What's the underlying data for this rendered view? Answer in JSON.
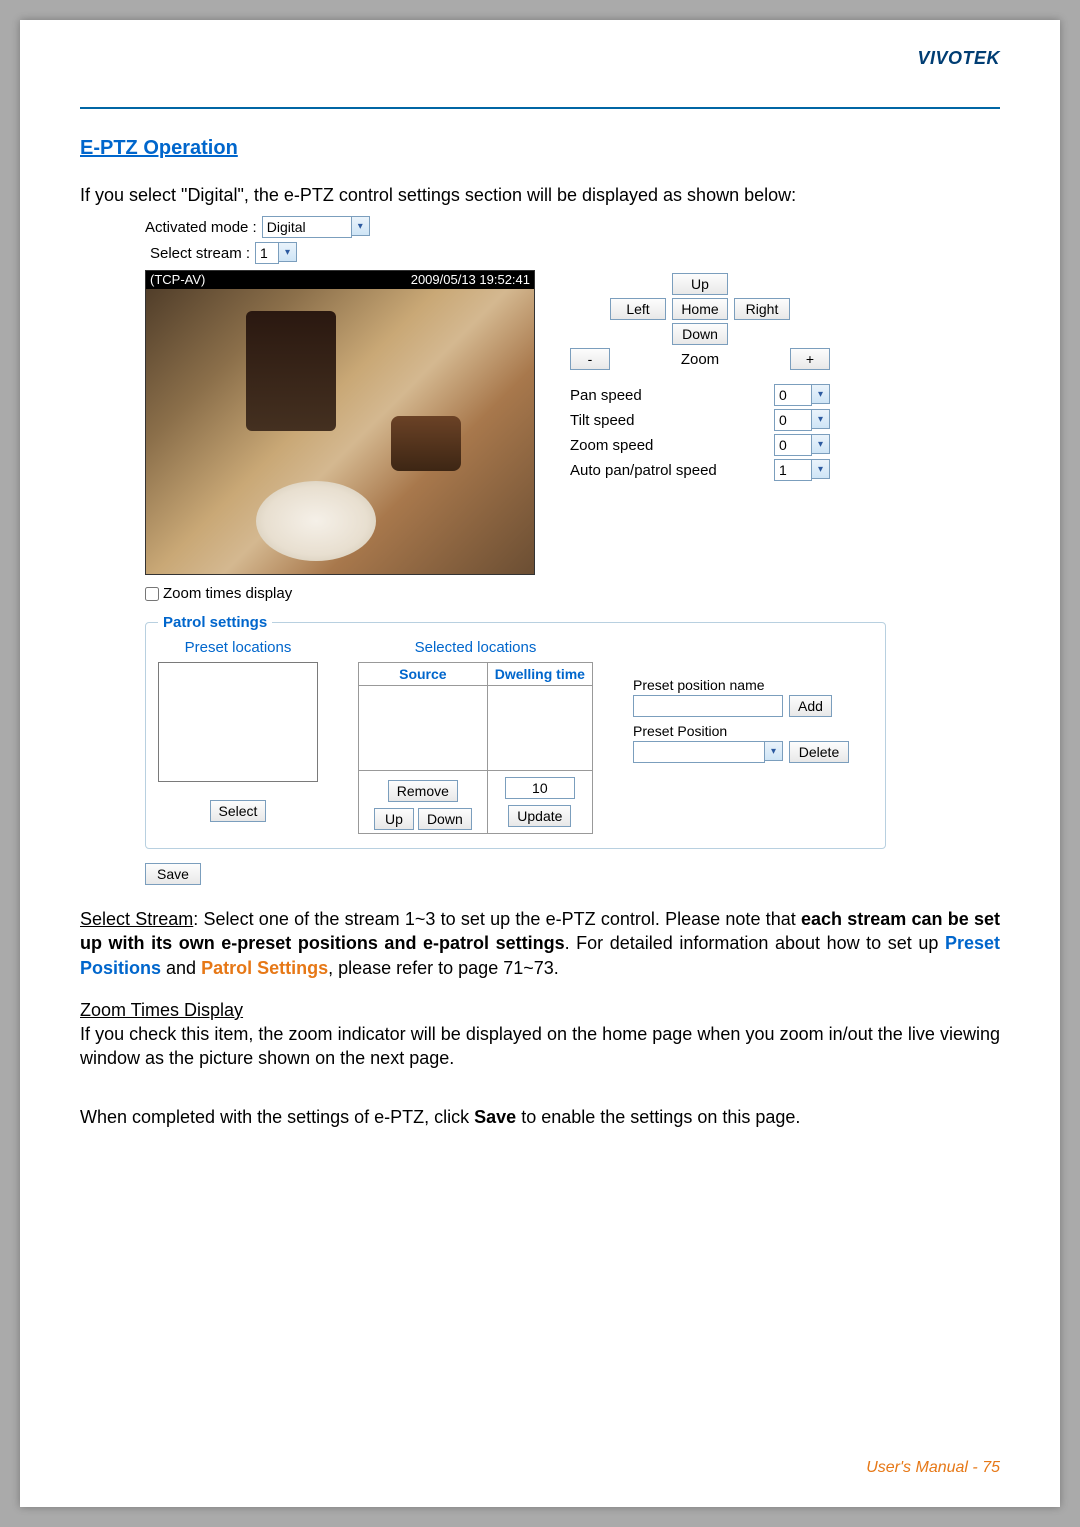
{
  "brand": "VIVOTEK",
  "section_title": "E-PTZ Operation",
  "intro": "If you select \"Digital\", the e-PTZ control settings section will be displayed as shown below:",
  "ui": {
    "activated_mode_label": "Activated mode :",
    "activated_mode_value": "Digital",
    "select_stream_label": "Select stream :",
    "select_stream_value": "1",
    "video_overlay_left": "(TCP-AV)",
    "video_overlay_right": "2009/05/13 19:52:41",
    "dpad": {
      "up": "Up",
      "left": "Left",
      "home": "Home",
      "right": "Right",
      "down": "Down"
    },
    "zoom": {
      "minus": "-",
      "label": "Zoom",
      "plus": "+"
    },
    "speeds": {
      "pan_label": "Pan speed",
      "pan_value": "0",
      "tilt_label": "Tilt speed",
      "tilt_value": "0",
      "zoom_label": "Zoom speed",
      "zoom_value": "0",
      "auto_label": "Auto pan/patrol speed",
      "auto_value": "1"
    },
    "zoom_times_display": "Zoom times display",
    "patrol": {
      "legend": "Patrol settings",
      "preset_locations": "Preset locations",
      "selected_locations": "Selected locations",
      "source": "Source",
      "dwelling_time": "Dwelling time",
      "select": "Select",
      "remove": "Remove",
      "up": "Up",
      "down": "Down",
      "dwell_value": "10",
      "update": "Update",
      "preset_position_name": "Preset position name",
      "add": "Add",
      "preset_position": "Preset Position",
      "delete": "Delete"
    },
    "save": "Save"
  },
  "body": {
    "p1_a": "Select Stream",
    "p1_b": ": Select one of the stream 1~3 to set up the e-PTZ control. Please note that ",
    "p1_c": "each stream can be set up with its own e-preset positions and e-patrol settings",
    "p1_d": ". For detailed information about how to set up ",
    "p1_e": "Preset Positions",
    "p1_f": " and ",
    "p1_g": "Patrol Settings",
    "p1_h": ", please refer to page 71~73.",
    "p2_a": "Zoom Times Display",
    "p2_b": "If you check this item, the zoom indicator will be displayed on the home page when you zoom in/out the live viewing window as the picture shown on the next page.",
    "p3": "When completed with the settings of e-PTZ, click ",
    "p3_b": "Save",
    "p3_c": " to enable the settings on this page."
  },
  "footer": {
    "label": "User's Manual - ",
    "page": "75"
  }
}
